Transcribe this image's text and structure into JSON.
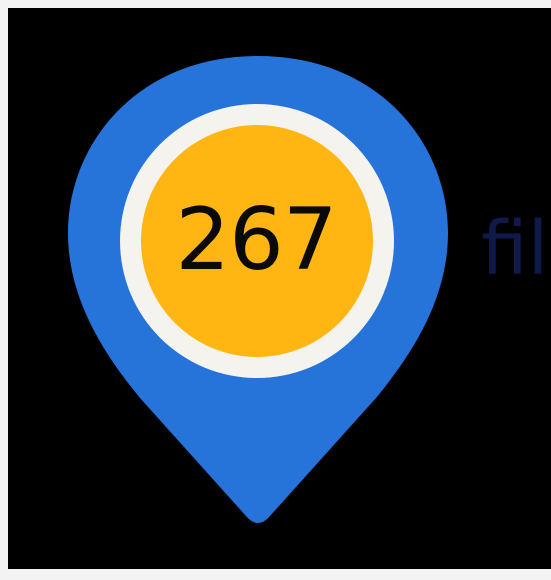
{
  "badge": {
    "count": "267",
    "trailing_text": "fil"
  },
  "icon": {
    "pin": "map-pin-icon"
  },
  "colors": {
    "background": "#000000",
    "pin": "#2673d9",
    "ring": "#f5f3ee",
    "center": "#ffb612",
    "count_text": "#0a0a0a",
    "trailing_text": "#0f1a4a"
  }
}
